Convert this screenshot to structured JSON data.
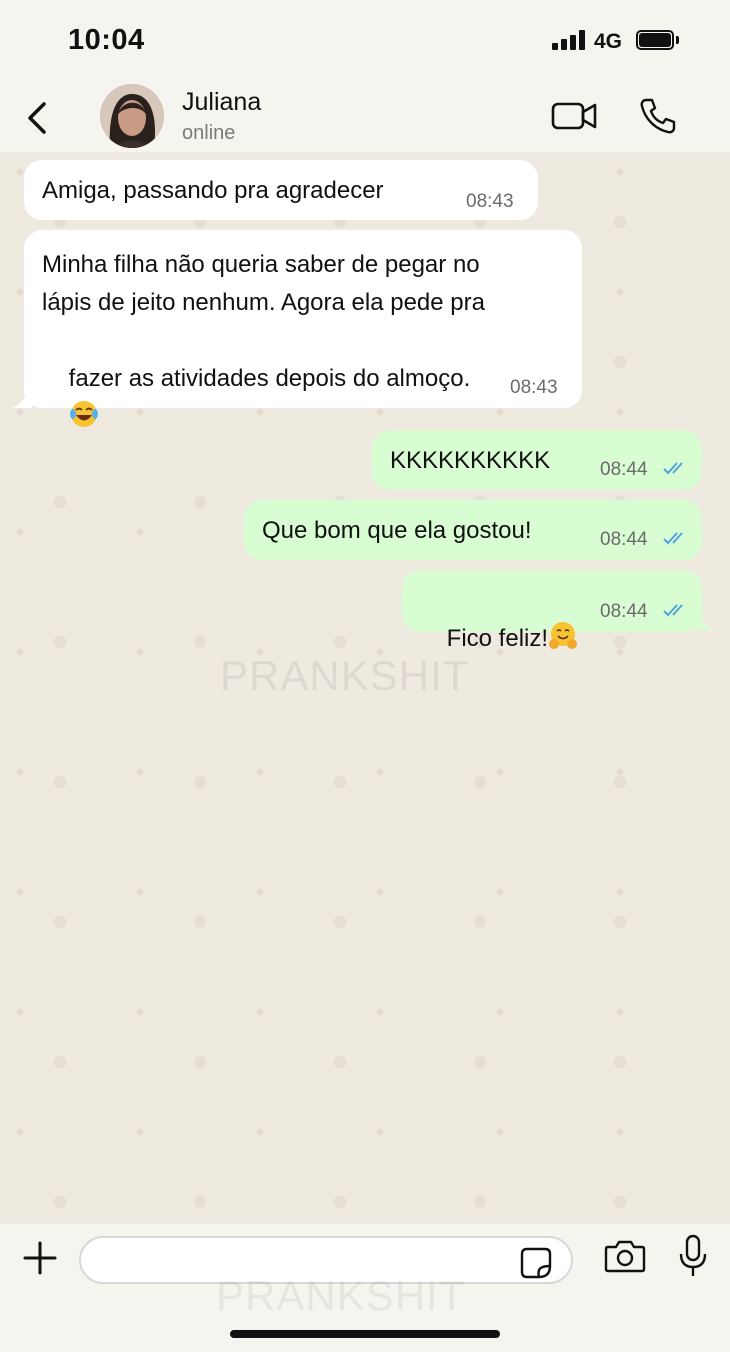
{
  "status_bar": {
    "time": "10:04",
    "network": "4G"
  },
  "header": {
    "contact_name": "Juliana",
    "contact_status": "online"
  },
  "messages": [
    {
      "direction": "in",
      "text": "Amiga, passando pra agradecer",
      "time": "08:43"
    },
    {
      "direction": "in",
      "lines": [
        "Minha filha não queria saber de pegar no",
        "lápis de jeito nenhum. Agora ela pede pra",
        "fazer as atividades depois do almoço."
      ],
      "emoji": "laughing-tears-emoji",
      "time": "08:43"
    },
    {
      "direction": "out",
      "text": "KKKKKKKKKK",
      "time": "08:44",
      "status": "read"
    },
    {
      "direction": "out",
      "text": "Que bom que ela gostou!",
      "time": "08:44",
      "status": "read"
    },
    {
      "direction": "out",
      "text": "Fico feliz!",
      "emoji": "hugging-face-emoji",
      "time": "08:44",
      "status": "read"
    }
  ],
  "watermark": "PRANKSHIT",
  "composer": {
    "placeholder": ""
  },
  "colors": {
    "incoming_bubble": "#ffffff",
    "outgoing_bubble": "#d9fdd3",
    "read_ticks": "#4fa3e0"
  }
}
